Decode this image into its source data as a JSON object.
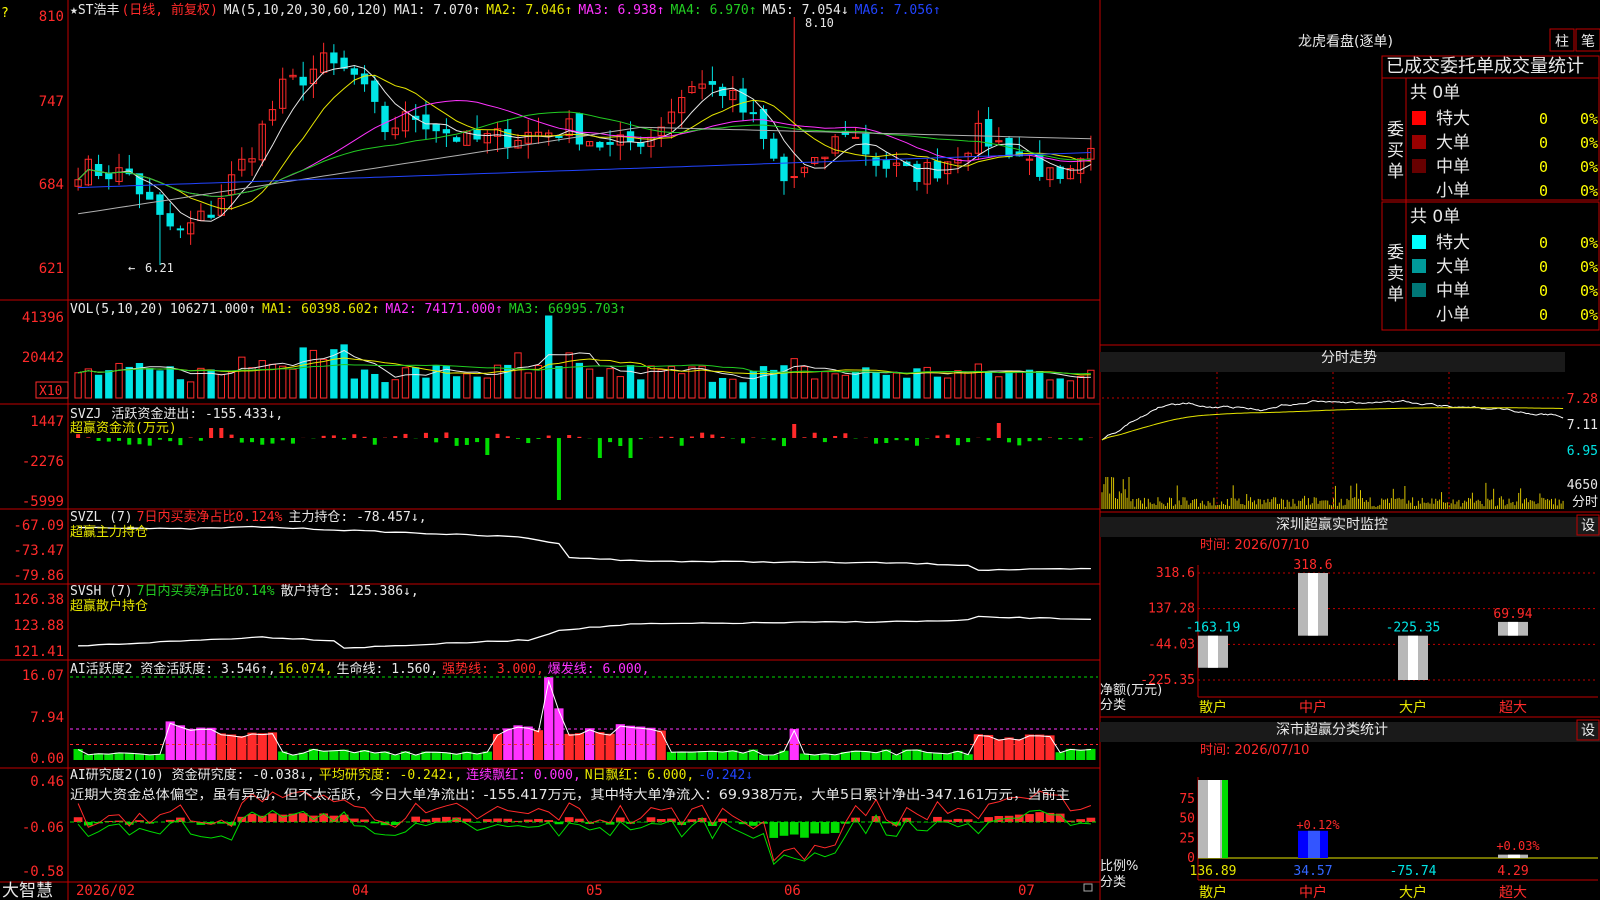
{
  "colors": {
    "frame": "#c00000",
    "up": "#ff2a2a",
    "down": "#00e5e5",
    "white": "#e8e8e8",
    "yellow": "#e6e600",
    "magenta": "#ff33ff",
    "green": "#22cc22",
    "blue": "#2244ff",
    "gray": "#b0b0b0",
    "barGreen": "#00dd00"
  },
  "header": {
    "star": "★",
    "name": "ST浩丰",
    "period": "(日线, 前复权)",
    "ma_label": "MA(5,10,20,30,60,120)",
    "ma1": "MA1: 7.070↑",
    "ma2": "MA2: 7.046↑",
    "ma3": "MA3: 6.938↑",
    "ma4": "MA4: 6.970↑",
    "ma5": "MA5: 7.054↓",
    "ma6": "MA6: 7.056↑",
    "high_note": "8.10",
    "low_note": "6.21",
    "arrow_note": "←"
  },
  "price_axis": [
    "810",
    "747",
    "684",
    "621"
  ],
  "vol": {
    "label": "VOL(5,10,20)",
    "value": "106271.000↑",
    "ma1": "MA1: 60398.602↑",
    "ma2": "MA2: 74171.000↑",
    "ma3": "MA3: 66995.703↑",
    "axis": [
      "41396",
      "20442"
    ],
    "unit": "X10"
  },
  "svzj": {
    "label": "SVZJ",
    "title": "活跃资金进出: -155.433↓,",
    "sub": "超赢资金流(万元)",
    "axis": [
      "1447",
      "-2276",
      "-5999"
    ]
  },
  "svzl": {
    "label": "SVZL (7)",
    "ratio": "7日内买卖净占比0.124%",
    "pos": "主力持仓: -78.457↓,",
    "sub": "超赢主力持仓",
    "axis": [
      "-67.09",
      "-73.47",
      "-79.86"
    ]
  },
  "svsh": {
    "label": "SVSH (7)",
    "ratio": "7日内买卖净占比0.14%",
    "pos": "散户持仓: 125.386↓,",
    "sub": "超赢散户持仓",
    "axis": [
      "126.38",
      "123.88",
      "121.41"
    ]
  },
  "ai1": {
    "label": "AI活跃度2 资金活跃度: 3.546↑,",
    "v2": "16.074,",
    "v3": "生命线: 1.560,",
    "v4": "强势线: 3.000,",
    "v5": "爆发线: 6.000,",
    "axis": [
      "16.07",
      "7.94",
      "0.00"
    ]
  },
  "ai2": {
    "label": "AI研究度2(10) 资金研究度: -0.038↓,",
    "v2": "平均研究度: -0.242↓,",
    "v3": "连续飘红: 0.000,",
    "v4": "N日飘红: 6.000,",
    "v5": "-0.242↓",
    "comment": "近期大资金总体偏空，虽有异动，但不太活跃，今日大单净流出：-155.417万元，其中特大单净流入：69.938万元，大单5日累计净出-347.161万元，当前主",
    "axis": [
      "0.46",
      "-0.06",
      "-0.58"
    ]
  },
  "xaxis": {
    "left": "大智慧",
    "labels": [
      "2026/02",
      "04",
      "05",
      "06",
      "07"
    ]
  },
  "lhb": {
    "title": "龙虎看盘(逐单)",
    "btn1": "柱",
    "btn2": "笔",
    "header": "已成交委托单成交量统计",
    "buy": {
      "side": "委买单",
      "total": "共 0单",
      "rows": [
        {
          "name": "特大",
          "qty": "0",
          "pct": "0%"
        },
        {
          "name": "大单",
          "qty": "0",
          "pct": "0%"
        },
        {
          "name": "中单",
          "qty": "0",
          "pct": "0%"
        },
        {
          "name": "小单",
          "qty": "0",
          "pct": "0%"
        }
      ]
    },
    "sell": {
      "side": "委卖单",
      "total": "共 0单",
      "rows": [
        {
          "name": "特大",
          "qty": "0",
          "pct": "0%"
        },
        {
          "name": "大单",
          "qty": "0",
          "pct": "0%"
        },
        {
          "name": "中单",
          "qty": "0",
          "pct": "0%"
        },
        {
          "name": "小单",
          "qty": "0",
          "pct": "0%"
        }
      ]
    }
  },
  "intraday": {
    "title": "分时走势",
    "axis": [
      "7.28",
      "7.11",
      "6.95"
    ],
    "vol_label": "4650",
    "vol_unit": "分时"
  },
  "monitor": {
    "title": "深圳超赢实时监控",
    "btn": "设",
    "time": "时间: 2026/07/10",
    "axis": [
      "318.6",
      "137.28",
      "-44.03",
      "-225.35"
    ],
    "unit": "净额(万元)",
    "cat_label": "分类"
  },
  "classify": {
    "title": "深市超赢分类统计",
    "btn": "设",
    "time": "时间: 2026/07/10",
    "axis": [
      "75",
      "50",
      "25",
      "0"
    ],
    "unit": "比例%",
    "cat_label": "分类"
  },
  "chart_data": [
    {
      "type": "bar",
      "title": "深圳超赢实时监控",
      "ylabel": "净额(万元)",
      "categories": [
        "散户",
        "中户",
        "大户",
        "超大"
      ],
      "values": [
        -163.19,
        318.6,
        -225.35,
        69.94
      ],
      "ylim": [
        -225.35,
        318.6
      ]
    },
    {
      "type": "bar",
      "title": "深市超赢分类统计",
      "ylabel": "比例%",
      "categories": [
        "散户",
        "中户",
        "大户",
        "超大"
      ],
      "values": [
        136.89,
        34.57,
        -75.74,
        4.29
      ],
      "deltas": [
        "",
        "+0.12%",
        "",
        "+0.03%"
      ],
      "ylim": [
        0,
        75
      ]
    }
  ]
}
